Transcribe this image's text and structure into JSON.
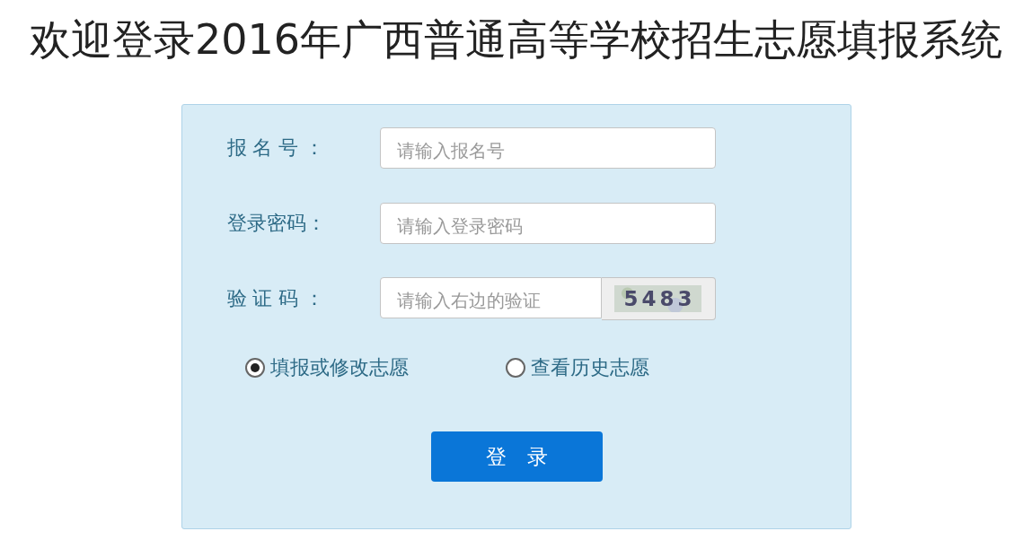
{
  "title": "欢迎登录2016年广西普通高等学校招生志愿填报系统",
  "fields": [
    {
      "kind": "text",
      "label": "报 名 号 ：",
      "placeholder": "请输入报名号"
    },
    {
      "kind": "password",
      "label": "登录密码：",
      "placeholder": "请输入登录密码"
    },
    {
      "kind": "captcha",
      "label": "验 证 码 ：",
      "placeholder": "请输入右边的验证",
      "captcha": "5483"
    }
  ],
  "options": [
    {
      "label": "填报或修改志愿",
      "selected": true
    },
    {
      "label": "查看历史志愿",
      "selected": false
    }
  ],
  "button": "登　录"
}
